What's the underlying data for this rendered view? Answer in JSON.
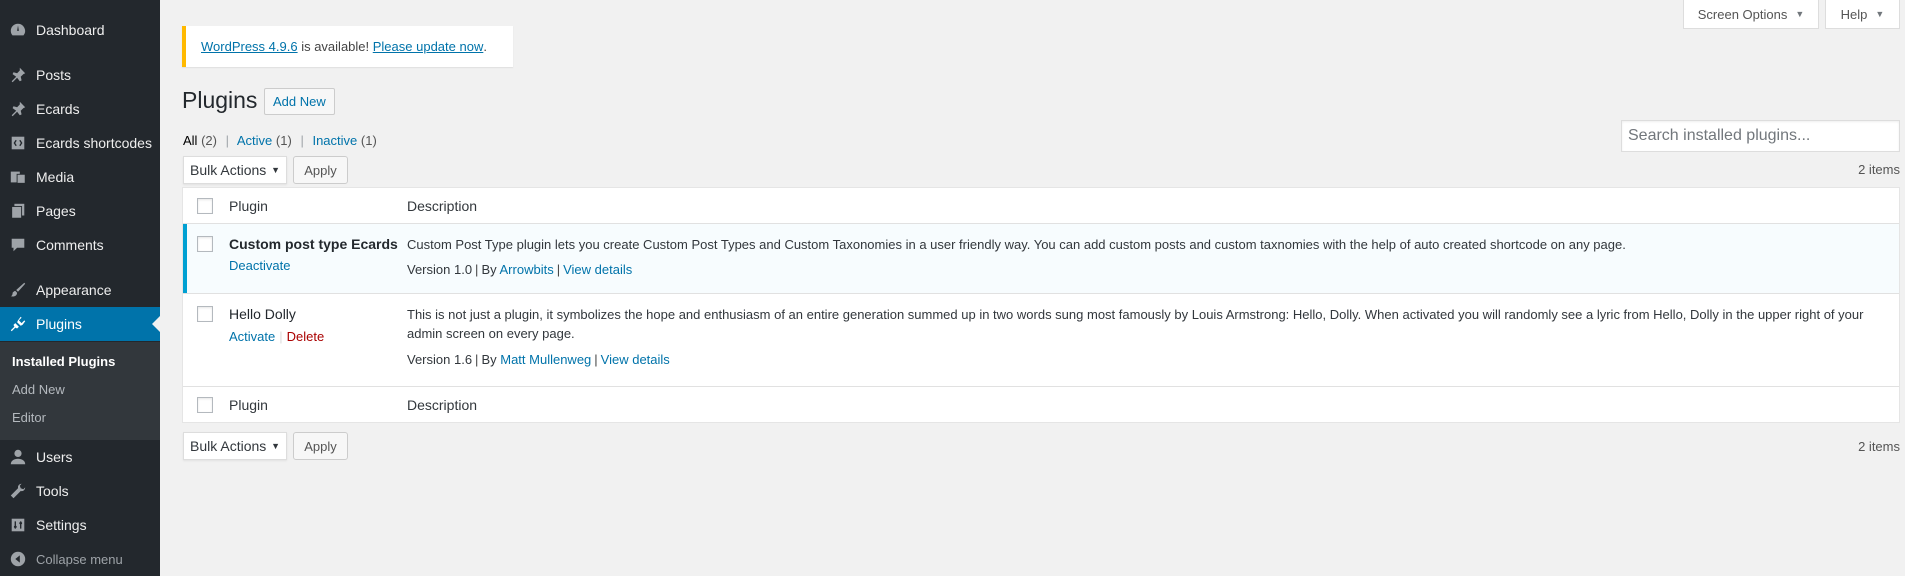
{
  "sidebar": {
    "items": [
      {
        "label": "Dashboard",
        "icon": "dashboard-icon"
      },
      {
        "label": "Posts",
        "icon": "pin-icon"
      },
      {
        "label": "Ecards",
        "icon": "pin-icon"
      },
      {
        "label": "Ecards shortcodes",
        "icon": "shortcode-icon"
      },
      {
        "label": "Media",
        "icon": "media-icon"
      },
      {
        "label": "Pages",
        "icon": "pages-icon"
      },
      {
        "label": "Comments",
        "icon": "comment-icon"
      },
      {
        "label": "Appearance",
        "icon": "paintbrush-icon"
      },
      {
        "label": "Plugins",
        "icon": "plugin-icon"
      },
      {
        "label": "Users",
        "icon": "users-icon"
      },
      {
        "label": "Tools",
        "icon": "wrench-icon"
      },
      {
        "label": "Settings",
        "icon": "settings-icon"
      }
    ],
    "submenu": [
      "Installed Plugins",
      "Add New",
      "Editor"
    ],
    "collapse_label": "Collapse menu"
  },
  "top_tabs": {
    "screen_options": "Screen Options",
    "help": "Help"
  },
  "notice": {
    "version_link": "WordPress 4.9.6",
    "middle_text": " is available! ",
    "update_link": "Please update now",
    "end_text": "."
  },
  "header": {
    "title": "Plugins",
    "add_new": "Add New"
  },
  "filters": {
    "all": "All",
    "all_count": "(2)",
    "active": "Active",
    "active_count": "(1)",
    "inactive": "Inactive",
    "inactive_count": "(1)",
    "separator": "|"
  },
  "search": {
    "placeholder": "Search installed plugins..."
  },
  "bulk": {
    "label": "Bulk Actions",
    "apply": "Apply",
    "items_count": "2 items"
  },
  "table": {
    "col_plugin": "Plugin",
    "col_description": "Description",
    "rows": [
      {
        "name": "Custom post type Ecards",
        "action1": "Deactivate",
        "description": "Custom Post Type plugin lets you create Custom Post Types and Custom Taxonomies in a user friendly way. You can add custom posts and custom taxnomies with the help of auto created shortcode on any page.",
        "version": "Version 1.0",
        "by": "By",
        "author": "Arrowbits",
        "view_details": "View details"
      },
      {
        "name": "Hello Dolly",
        "action1": "Activate",
        "action2": "Delete",
        "description": "This is not just a plugin, it symbolizes the hope and enthusiasm of an entire generation summed up in two words sung most famously by Louis Armstrong: Hello, Dolly. When activated you will randomly see a lyric from Hello, Dolly in the upper right of your admin screen on every page.",
        "version": "Version 1.6",
        "by": "By",
        "author": "Matt Mullenweg",
        "view_details": "View details"
      }
    ]
  },
  "colors": {
    "sidebar": "#23282d",
    "accent": "#0073aa",
    "notice": "#ffb900",
    "active_row_border": "#00a0d2"
  }
}
